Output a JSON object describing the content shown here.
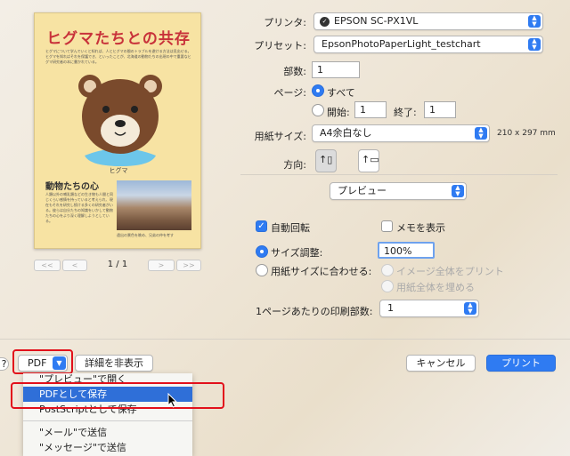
{
  "preview": {
    "doc_title": "ヒグマたちとの共存",
    "intro_text": "ヒグマについて学んでいくと知れば、人とヒグマの間のトラブルを避ける方法は見出せる。ヒグマを知ればそれを保護でき、といったことが、北海道の動物たちの出現の中で重要なヒグマ研究者の本に書かれている。",
    "bear_label": "ヒグマ",
    "animals_heading": "動物たちの心",
    "animals_text": "人類以外の哺乳類などの生き物も人間と同じくらい感情を持っていると考えられ、現在もそれを研究し続ける多くの研究者がいる。彼らは自分たちの知識をいかして動物たちの心をより深く理解しようとしている。",
    "photo_caption": "遠出の景色を眺め、兄弟の仲を考す",
    "page_indicator": "1 / 1",
    "nav_first": "<<",
    "nav_prev": "<",
    "nav_next": ">",
    "nav_last": ">>"
  },
  "form": {
    "printer_label": "プリンタ:",
    "printer_value": "EPSON SC-PX1VL",
    "preset_label": "プリセット:",
    "preset_value": "EpsonPhotoPaperLight_testchart",
    "copies_label": "部数:",
    "copies_value": "1",
    "pages_label": "ページ:",
    "pages_all": "すべて",
    "pages_from_label": "開始:",
    "pages_from_value": "1",
    "pages_to_label": "終了:",
    "pages_to_value": "1",
    "paper_label": "用紙サイズ:",
    "paper_value": "A4余白なし",
    "paper_dims": "210 x 297 mm",
    "orientation_label": "方向:",
    "section_value": "プレビュー",
    "auto_rotate": "自動回転",
    "show_notes": "メモを表示",
    "scale_label": "サイズ調整:",
    "scale_value": "100%",
    "fit_label": "用紙サイズに合わせる:",
    "fit_entire": "イメージ全体をプリント",
    "fill_paper": "用紙全体を埋める",
    "pages_per_sheet_label": "1ページあたりの印刷部数:",
    "pages_per_sheet_value": "1"
  },
  "footer": {
    "help": "?",
    "pdf": "PDF",
    "hide_details": "詳細を非表示",
    "cancel": "キャンセル",
    "print": "プリント"
  },
  "pdf_menu": {
    "items": [
      "\"プレビュー\"で開く",
      "PDFとして保存",
      "PostScriptとして保存",
      "\"メール\"で送信",
      "\"メッセージ\"で送信"
    ]
  },
  "colors": {
    "accent": "#2f7bf2",
    "highlight": "#e2101b",
    "menu_selected": "#2f6fd8"
  }
}
